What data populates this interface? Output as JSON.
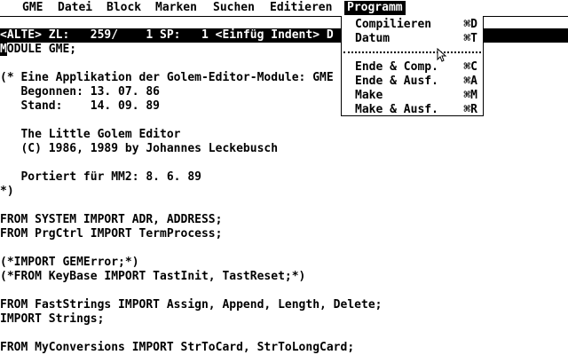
{
  "menubar": {
    "items": [
      {
        "label": "GME"
      },
      {
        "label": "Datei"
      },
      {
        "label": "Block"
      },
      {
        "label": "Marken"
      },
      {
        "label": "Suchen"
      },
      {
        "label": "Editieren"
      },
      {
        "label": "Programm"
      }
    ]
  },
  "status": {
    "text": "<ALTE> ZL:   259/    1 SP:   1 <Einfüg Indent> D"
  },
  "editor": {
    "cursor_char": "M",
    "lines": [
      "ODULE GME;",
      "",
      "(* Eine Applikation der Golem-Editor-Module: GME",
      "   Begonnen: 13. 07. 86",
      "   Stand:    14. 09. 89",
      "",
      "   The Little Golem Editor",
      "   (C) 1986, 1989 by Johannes Leckebusch",
      "",
      "   Portiert für MM2: 8. 6. 89",
      "*)",
      "",
      "FROM SYSTEM IMPORT ADR, ADDRESS;",
      "FROM PrgCtrl IMPORT TermProcess;",
      "",
      "(*IMPORT GEMError;*)",
      "(*FROM KeyBase IMPORT TastInit, TastReset;*)",
      "",
      "FROM FastStrings IMPORT Assign, Append, Length, Delete;",
      "IMPORT Strings;",
      "",
      "FROM MyConversions IMPORT StrToCard, StrToLongCard;"
    ]
  },
  "dropdown": {
    "items": [
      {
        "label": "Compilieren",
        "shortcut": "⌘D"
      },
      {
        "label": "Datum",
        "shortcut": "⌘T"
      },
      {
        "label": "Ende & Comp.",
        "shortcut": "⌘C"
      },
      {
        "label": "Ende & Ausf.",
        "shortcut": "⌘A"
      },
      {
        "label": "Make",
        "shortcut": "⌘M"
      },
      {
        "label": "Make & Ausf.",
        "shortcut": "⌘R"
      }
    ]
  }
}
